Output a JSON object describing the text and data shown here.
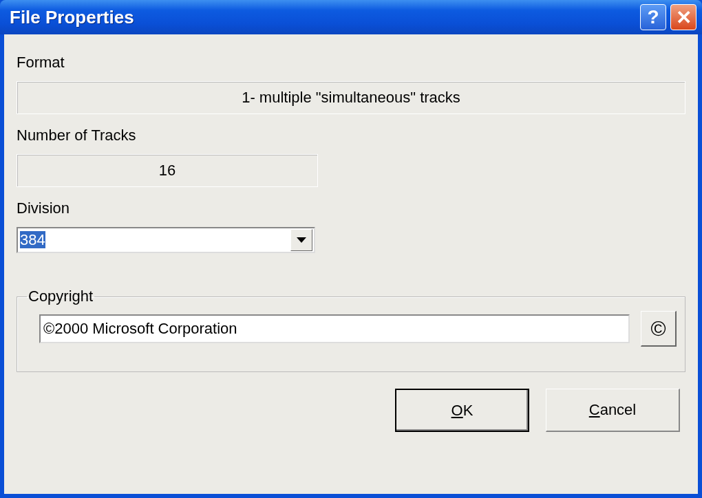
{
  "window": {
    "title": "File Properties",
    "help_button": "?",
    "close_button": "✕"
  },
  "format": {
    "label": "Format",
    "value": "1- multiple \"simultaneous\" tracks"
  },
  "tracks": {
    "label": "Number of Tracks",
    "value": "16"
  },
  "division": {
    "label": "Division",
    "value": "384",
    "text_selected": true
  },
  "copyright": {
    "legend": "Copyright",
    "value": "©2000 Microsoft Corporation",
    "symbol_button": "©"
  },
  "buttons": [
    {
      "label": "OK",
      "default": true,
      "mnemonic_underlined": true
    },
    {
      "label": "Cancel",
      "default": false,
      "mnemonic_underlined": true
    }
  ]
}
